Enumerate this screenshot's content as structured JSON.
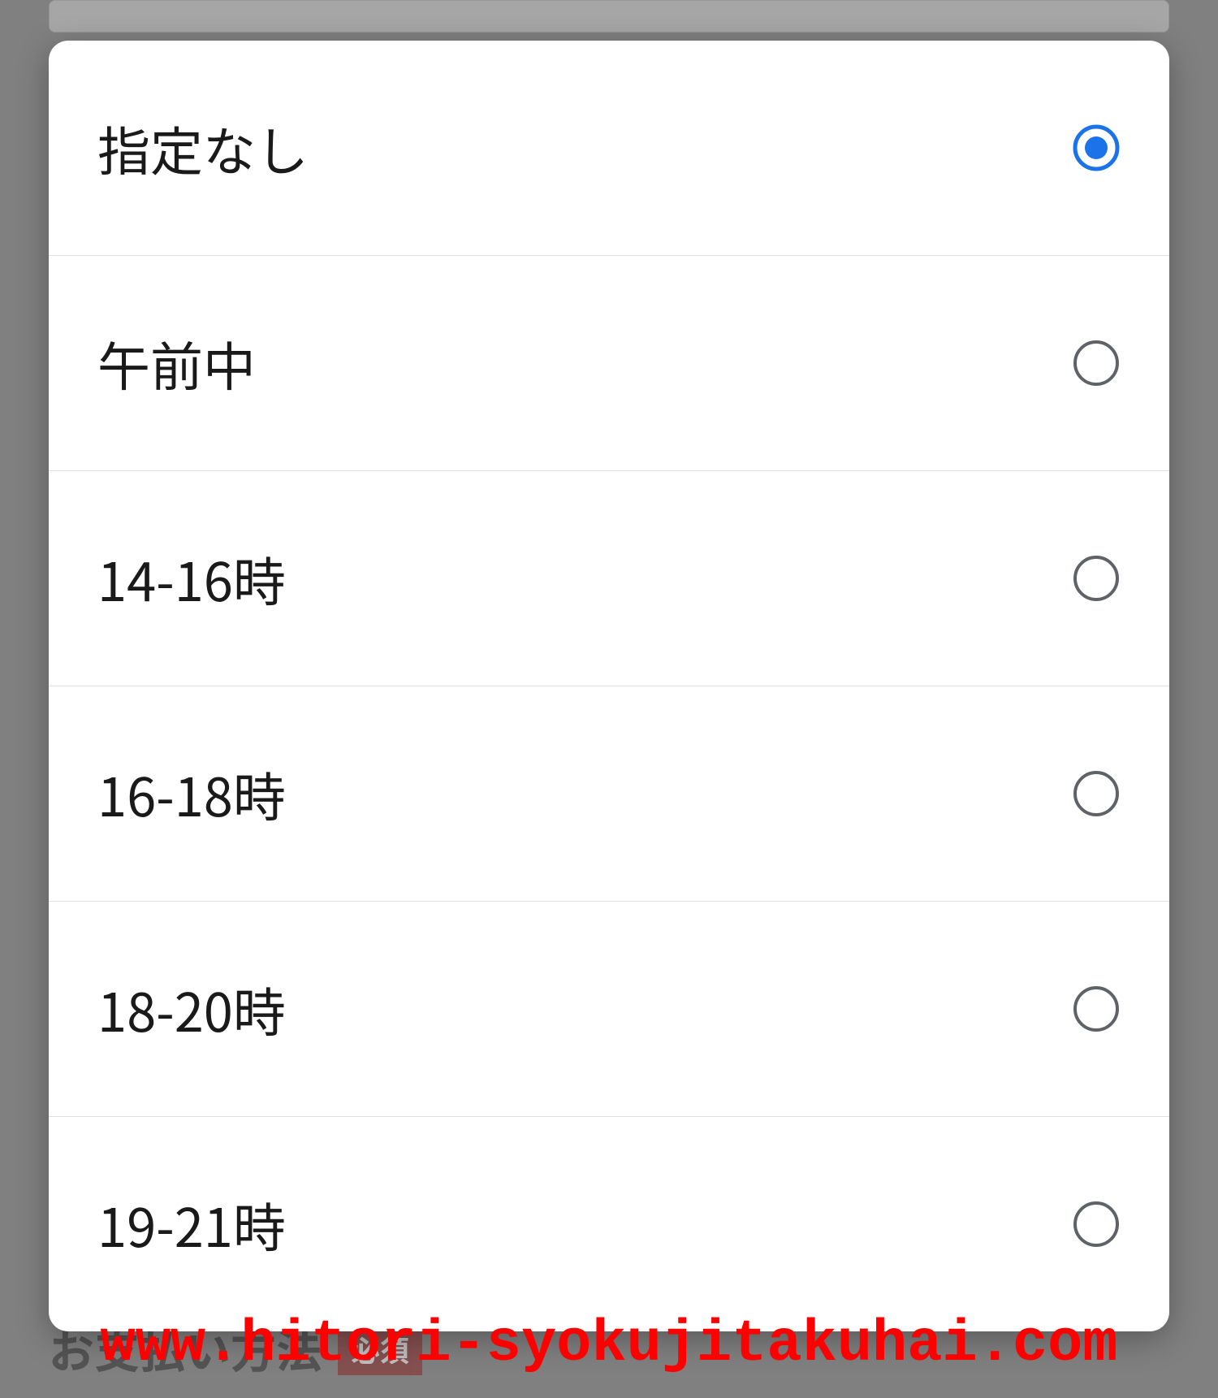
{
  "dialog": {
    "options": [
      {
        "label": "指定なし",
        "selected": true
      },
      {
        "label": "午前中",
        "selected": false
      },
      {
        "label": "14-16時",
        "selected": false
      },
      {
        "label": "16-18時",
        "selected": false
      },
      {
        "label": "18-20時",
        "selected": false
      },
      {
        "label": "19-21時",
        "selected": false
      }
    ]
  },
  "background": {
    "section_title": "お支払い方法",
    "badge": "必須"
  },
  "watermark": "www.hitori-syokujitakuhai.com"
}
